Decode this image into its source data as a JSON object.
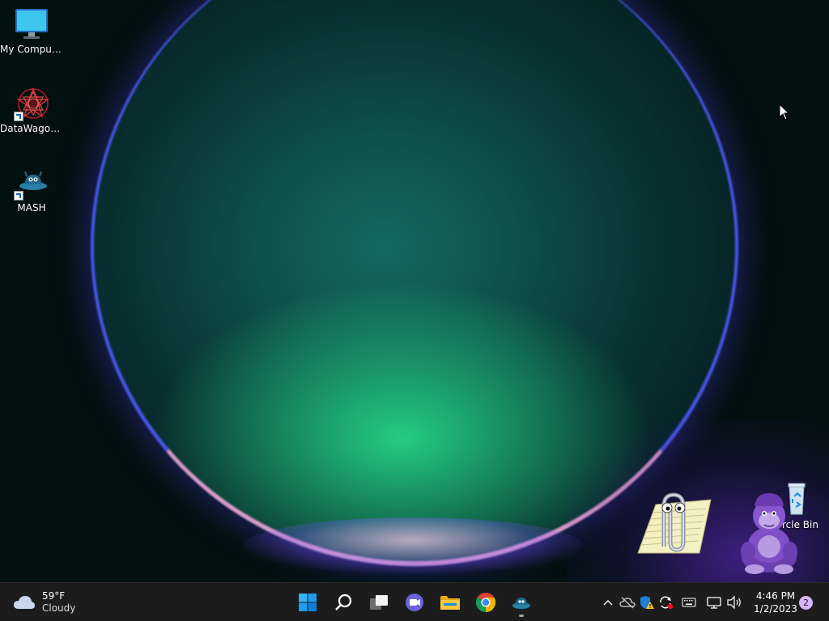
{
  "desktop": {
    "icons": [
      {
        "label": "My Computer",
        "icon": "monitor-icon"
      },
      {
        "label": "DataWagon...",
        "icon": "datawagon-icon"
      },
      {
        "label": "MASH",
        "icon": "mash-icon"
      },
      {
        "label": "Recycle Bin",
        "icon": "recycle-bin-icon",
        "visible_label": "rcle Bin"
      }
    ],
    "agents": [
      {
        "name": "Clippy",
        "icon": "paperclip-assistant-icon"
      },
      {
        "name": "Bonzi",
        "icon": "purple-gorilla-assistant-icon"
      }
    ]
  },
  "taskbar": {
    "weather": {
      "temperature": "59°F",
      "condition": "Cloudy",
      "icon": "cloud-icon"
    },
    "apps": [
      {
        "name": "start",
        "icon": "windows-logo-icon"
      },
      {
        "name": "search",
        "icon": "search-icon"
      },
      {
        "name": "task-view",
        "icon": "task-view-icon"
      },
      {
        "name": "chat",
        "icon": "teams-chat-icon"
      },
      {
        "name": "file-explorer",
        "icon": "folder-icon"
      },
      {
        "name": "chrome",
        "icon": "chrome-icon"
      },
      {
        "name": "mash",
        "icon": "mash-icon",
        "running": true
      }
    ],
    "tray": {
      "icons": [
        "chevron-up-icon",
        "onedrive-offline-icon",
        "security-warning-icon",
        "sync-error-icon",
        "keyboard-icon",
        "network-icon",
        "volume-icon"
      ],
      "time": "4:46 PM",
      "date": "1/2/2023",
      "notification_count": "2"
    }
  },
  "colors": {
    "taskbar_bg": "#1c1c1c",
    "accent": "#0078d4",
    "badge": "#d8b4f8"
  }
}
